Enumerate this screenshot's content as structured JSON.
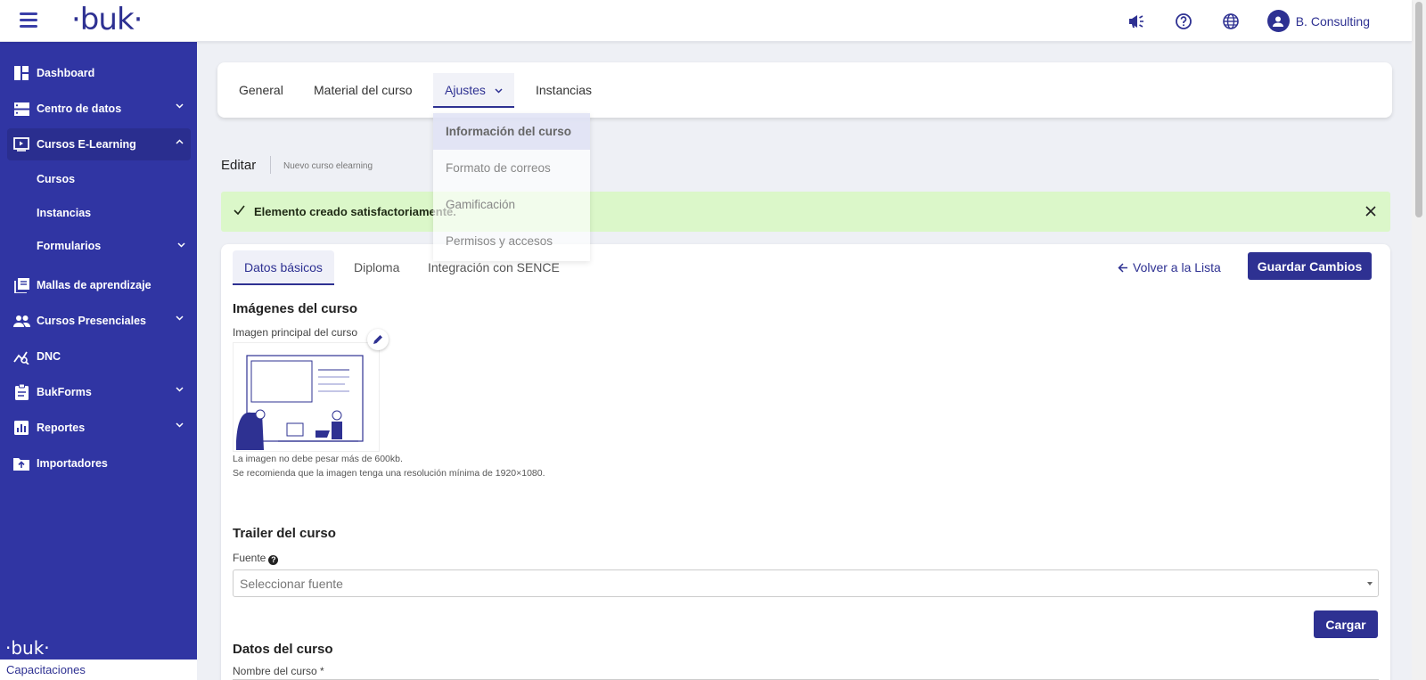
{
  "app": {
    "logo_text": "·buk·",
    "user_name": "B. Consulting"
  },
  "topbar": {
    "icons": [
      "megaphone-icon",
      "help-circle-icon",
      "globe-icon",
      "user-avatar-icon"
    ]
  },
  "sidebar": {
    "items": [
      {
        "label": "Dashboard",
        "icon": "dashboard-icon"
      },
      {
        "label": "Centro de datos",
        "icon": "server-icon",
        "expandable": true
      },
      {
        "label": "Cursos E-Learning",
        "icon": "video-icon",
        "expandable": true,
        "expanded": true
      },
      {
        "label": "Mallas de aprendizaje",
        "icon": "library-icon"
      },
      {
        "label": "Cursos Presenciales",
        "icon": "people-icon",
        "expandable": true
      },
      {
        "label": "DNC",
        "icon": "analytics-icon"
      },
      {
        "label": "BukForms",
        "icon": "clipboard-icon",
        "expandable": true
      },
      {
        "label": "Reportes",
        "icon": "bar-chart-icon",
        "expandable": true
      },
      {
        "label": "Importadores",
        "icon": "upload-folder-icon"
      }
    ],
    "subitems": [
      "Cursos",
      "Instancias",
      "Formularios"
    ],
    "footer_logo": "·buk·",
    "footer_label": "Capacitaciones"
  },
  "top_tabs": [
    "General",
    "Material del curso",
    "Ajustes",
    "Instancias"
  ],
  "ajustes_menu": [
    "Información del curso",
    "Formato de correos",
    "Gamificación",
    "Permisos y accesos"
  ],
  "header": {
    "title": "Editar",
    "subtitle": "Nuevo curso elearning"
  },
  "alert": {
    "message": "Elemento creado satisfactoriamente.",
    "color": "#dbf7c9"
  },
  "form_tabs": [
    "Datos básicos",
    "Diploma",
    "Integración con SENCE"
  ],
  "actions": {
    "back": "Volver a la Lista",
    "save": "Guardar Cambios"
  },
  "images_section": {
    "title": "Imágenes del curso",
    "main_image_label": "Imagen principal del curso",
    "hint_1": "La imagen no debe pesar más de 600kb.",
    "hint_2": "Se recomienda que la imagen tenga una resolución mínima de 1920×1080."
  },
  "trailer_section": {
    "title": "Trailer del curso",
    "source_label": "Fuente",
    "source_placeholder": "Seleccionar fuente",
    "load_button": "Cargar"
  },
  "course_data_section": {
    "title": "Datos del curso",
    "name_label": "Nombre del curso *"
  },
  "colors": {
    "brand": "#2e3192",
    "sidebar": "#3035a3",
    "background": "#eef0f5"
  }
}
